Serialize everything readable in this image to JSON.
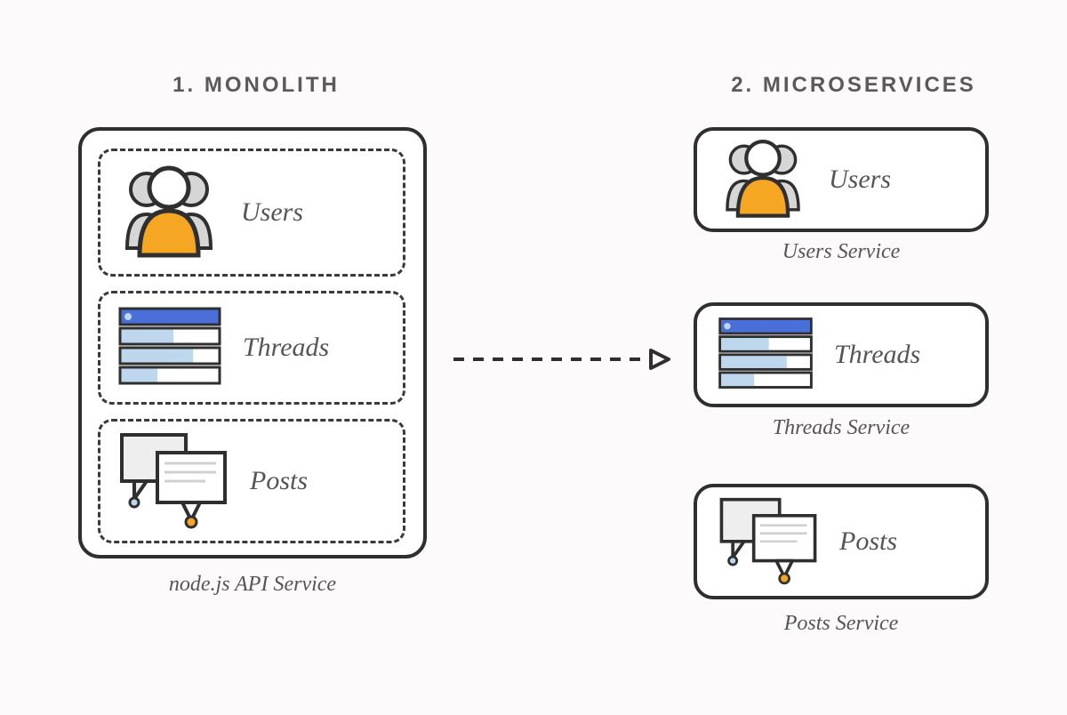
{
  "headings": {
    "monolith": "1. MONOLITH",
    "microservices": "2. MICROSERVICES"
  },
  "monolith": {
    "caption": "node.js API Service",
    "modules": {
      "users": {
        "label": "Users"
      },
      "threads": {
        "label": "Threads"
      },
      "posts": {
        "label": "Posts"
      }
    }
  },
  "microservices": {
    "users": {
      "label": "Users",
      "caption": "Users Service"
    },
    "threads": {
      "label": "Threads",
      "caption": "Threads Service"
    },
    "posts": {
      "label": "Posts",
      "caption": "Posts Service"
    }
  },
  "colors": {
    "orange": "#f5a623",
    "blue": "#4a6fd8",
    "lightblue": "#bfd7ed",
    "grey": "#d0d0d0",
    "line": "#2f2f2f"
  }
}
